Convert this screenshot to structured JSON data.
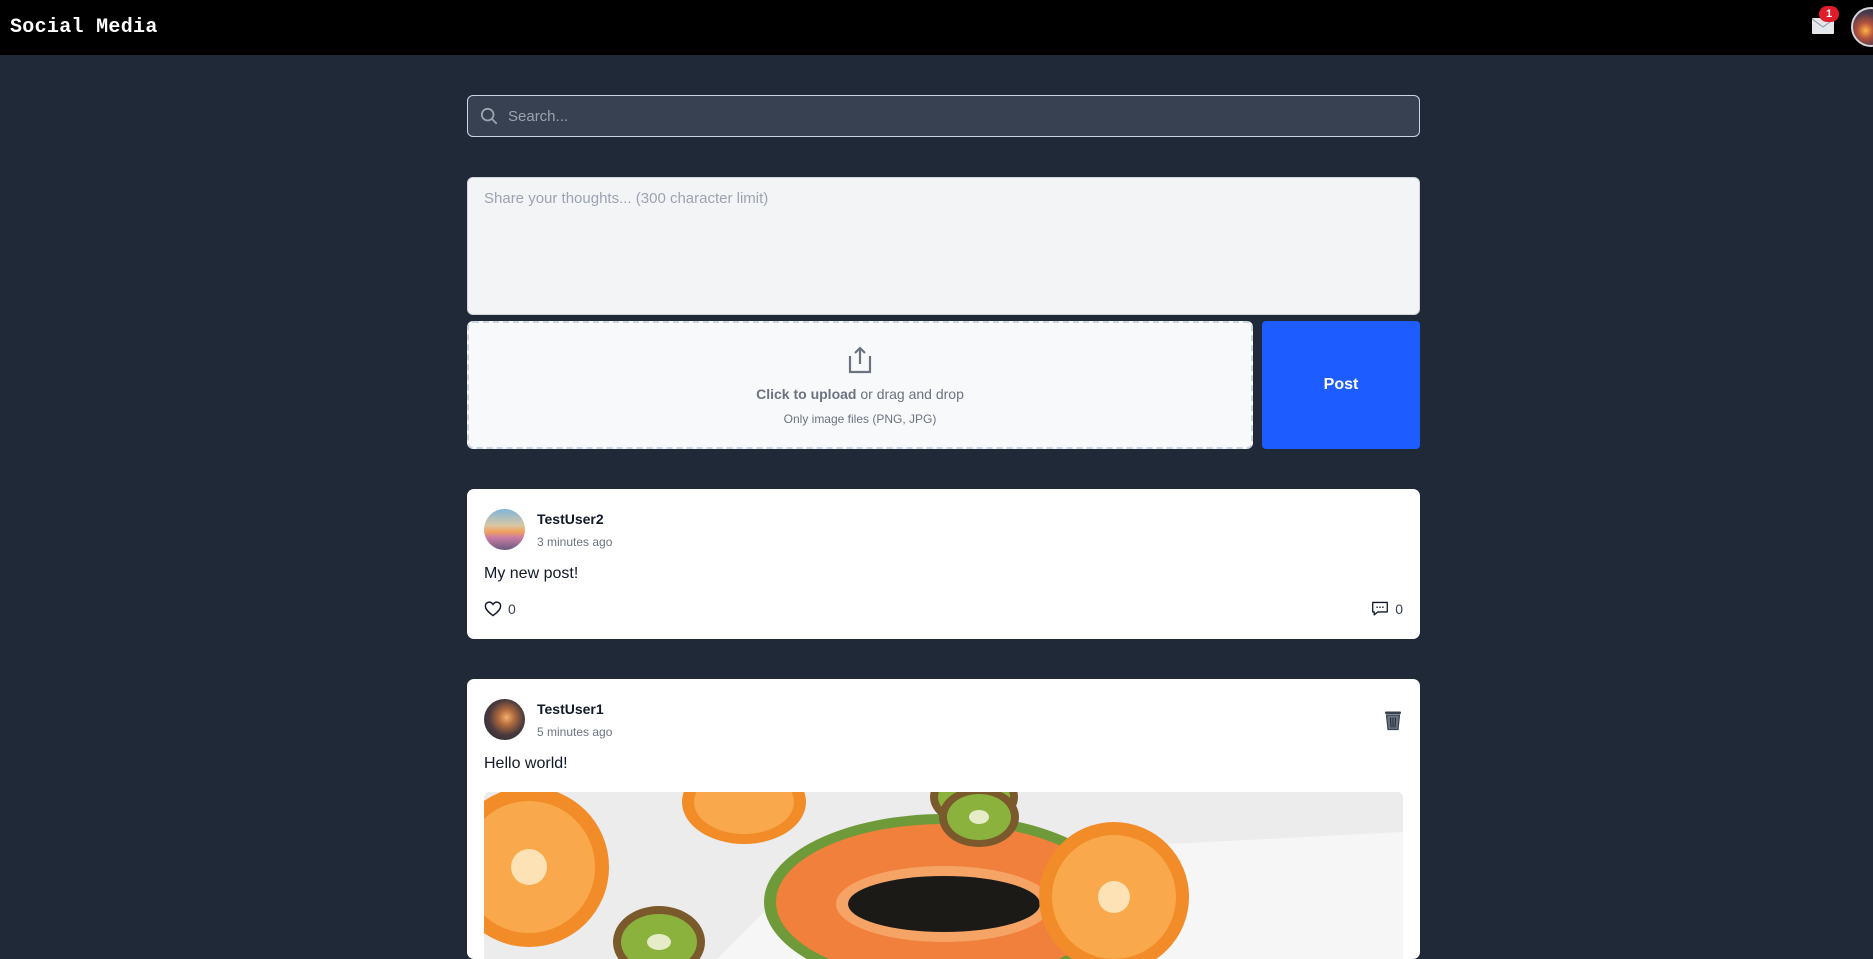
{
  "app": {
    "title": "Social Media"
  },
  "notifications": {
    "count": "1"
  },
  "search": {
    "placeholder": "Search..."
  },
  "composer": {
    "placeholder": "Share your thoughts... (300 character limit)"
  },
  "upload": {
    "strong": "Click to upload",
    "rest": " or drag and drop",
    "hint": "Only image files (PNG, JPG)"
  },
  "post_button": {
    "label": "Post"
  },
  "posts": [
    {
      "username": "TestUser2",
      "time": "3 minutes ago",
      "text": "My new post!",
      "likes": "0",
      "comments": "0"
    },
    {
      "username": "TestUser1",
      "time": "5 minutes ago",
      "text": "Hello world!"
    }
  ],
  "icons": {
    "inbox": "inbox-icon",
    "search": "search-icon",
    "upload": "share-upload-icon",
    "like": "heart-icon",
    "comment": "comment-icon",
    "delete": "trash-icon"
  }
}
